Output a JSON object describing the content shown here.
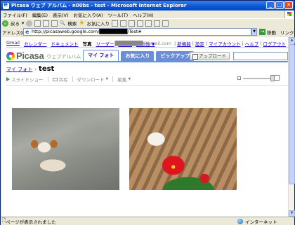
{
  "window": {
    "title": "Picasa ウェブ アルバム - n00bs - test - Microsoft Internet Explorer"
  },
  "menu": [
    "ファイル(F)",
    "編集(E)",
    "表示(V)",
    "お気に入り(A)",
    "ツール(T)",
    "ヘルプ(H)"
  ],
  "toolbar": {
    "back_label": "戻る",
    "search_label": "検索",
    "favorites_label": "お気に入り"
  },
  "addressbar": {
    "label": "アドレス(D)",
    "url": "http://picasaweb.google.com/████████/Test#",
    "go_label": "移動",
    "links_label": "リンク"
  },
  "gbar": {
    "items": [
      "Gmail",
      "カレンダー",
      "ドキュメント",
      "写真",
      "リーダー",
      "ウェブ",
      "その他 ▼"
    ]
  },
  "user": {
    "email": "████████@gmail.com",
    "links": [
      "新機能",
      "設定",
      "マイアカウント",
      "ヘルプ",
      "ログアウト"
    ]
  },
  "logo": {
    "name": "Picasa",
    "sub": "ウェブアルバム"
  },
  "tabs": [
    "マイ フォト",
    "お気に入り",
    "ピックアップ"
  ],
  "upload_label": "アップロード",
  "breadcrumb": {
    "root": "マイ フォト",
    "arrow": "›",
    "album": "test"
  },
  "actions": {
    "slideshow": "スライドショー",
    "share": "共有",
    "download": "ダウンロード",
    "edit": "編集"
  },
  "thumb_size_level": 1.0,
  "status": {
    "text": "ページが表示されました",
    "zone": "インターネット"
  },
  "photos": [
    {
      "subject": "dog"
    },
    {
      "subject": "flower"
    }
  ]
}
